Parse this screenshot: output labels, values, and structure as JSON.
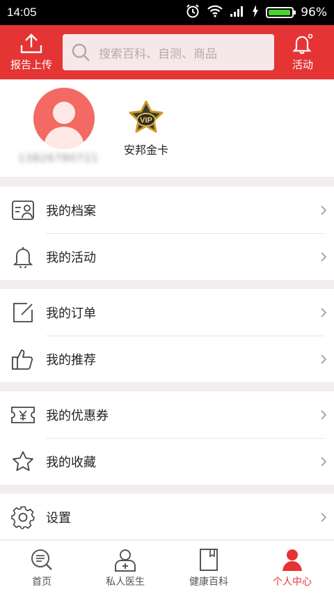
{
  "status_bar": {
    "time": "14:05",
    "battery": "96%",
    "battery_level": 0.96
  },
  "header": {
    "upload_label": "报告上传",
    "search_placeholder": "搜索百科、自测、商品",
    "activity_label": "活动"
  },
  "profile": {
    "phone": "13826780721",
    "vip_badge": "VIP",
    "member_level": "安邦金卡"
  },
  "menu_groups": [
    {
      "items": [
        {
          "label": "我的档案",
          "icon": "profile-card-icon"
        },
        {
          "label": "我的活动",
          "icon": "bell-icon"
        }
      ]
    },
    {
      "items": [
        {
          "label": "我的订单",
          "icon": "edit-order-icon"
        },
        {
          "label": "我的推荐",
          "icon": "thumbs-up-icon"
        }
      ]
    },
    {
      "items": [
        {
          "label": "我的优惠券",
          "icon": "coupon-icon"
        },
        {
          "label": "我的收藏",
          "icon": "star-icon"
        }
      ]
    },
    {
      "items": [
        {
          "label": "设置",
          "icon": "gear-icon"
        }
      ]
    }
  ],
  "tabbar": {
    "tabs": [
      {
        "label": "首页",
        "icon": "search-list-icon"
      },
      {
        "label": "私人医生",
        "icon": "doctor-icon"
      },
      {
        "label": "健康百科",
        "icon": "book-icon"
      },
      {
        "label": "个人中心",
        "icon": "person-icon"
      }
    ],
    "active_index": 3,
    "accent": "#e53434"
  },
  "colors": {
    "brand_red": "#e53434",
    "avatar_bg": "#f26a63",
    "page_bg": "#f3eeee"
  }
}
